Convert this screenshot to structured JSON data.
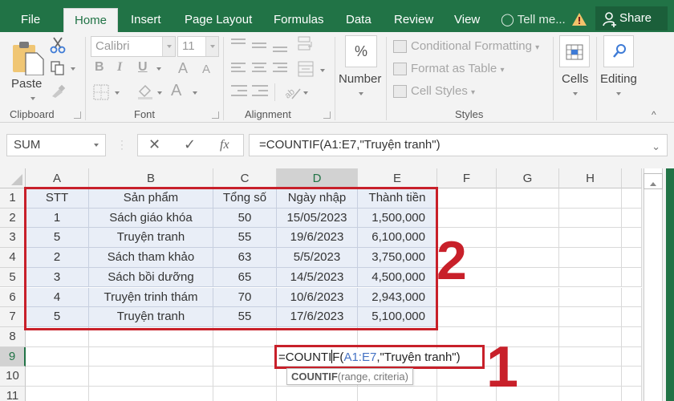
{
  "ribbon_tabs": [
    {
      "label": "File",
      "active": false
    },
    {
      "label": "Home",
      "active": true
    },
    {
      "label": "Insert",
      "active": false
    },
    {
      "label": "Page Layout",
      "active": false
    },
    {
      "label": "Formulas",
      "active": false
    },
    {
      "label": "Data",
      "active": false
    },
    {
      "label": "Review",
      "active": false
    },
    {
      "label": "View",
      "active": false
    }
  ],
  "tell_me": "Tell me...",
  "share_label": "Share",
  "clipboard": {
    "paste_label": "Paste",
    "group_label": "Clipboard"
  },
  "font": {
    "name": "Calibri",
    "size": "11",
    "group_label": "Font",
    "bold": "B",
    "italic": "I",
    "underline": "U",
    "grow": "A",
    "shrink": "A",
    "color": "A"
  },
  "alignment": {
    "group_label": "Alignment"
  },
  "number": {
    "symbol": "%",
    "label": "Number"
  },
  "styles": {
    "conditional_formatting": "Conditional Formatting",
    "format_as_table": "Format as Table",
    "cell_styles": "Cell Styles",
    "group_label": "Styles"
  },
  "cells": {
    "label": "Cells"
  },
  "editing": {
    "label": "Editing"
  },
  "formula_bar": {
    "name_box": "SUM",
    "cancel": "✕",
    "enter": "✓",
    "fx": "fx",
    "formula": "=COUNTIF(A1:E7,\"Truyện tranh\")"
  },
  "sheet": {
    "columns": [
      "A",
      "B",
      "C",
      "D",
      "E",
      "F",
      "G",
      "H"
    ],
    "rows": [
      "1",
      "2",
      "3",
      "4",
      "5",
      "6",
      "7",
      "8",
      "9",
      "10",
      "11"
    ],
    "header": [
      "STT",
      "Sản phẩm",
      "Tổng số",
      "Ngày nhập",
      "Thành tiền"
    ],
    "data": [
      [
        "1",
        "Sách giáo khóa",
        "50",
        "15/05/2023",
        "1,500,000"
      ],
      [
        "5",
        "Truyện tranh",
        "55",
        "19/6/2023",
        "6,100,000"
      ],
      [
        "2",
        "Sách tham khảo",
        "63",
        "5/5/2023",
        "3,750,000"
      ],
      [
        "3",
        "Sách bồi dưỡng",
        "65",
        "14/5/2023",
        "4,500,000"
      ],
      [
        "4",
        "Truyện trinh thám",
        "70",
        "10/6/2023",
        "2,943,000"
      ],
      [
        "5",
        "Truyện tranh",
        "55",
        "17/6/2023",
        "5,100,000"
      ]
    ],
    "active_row": "9",
    "active_col": "D"
  },
  "editing_cell": {
    "prefix": "=COUNTI",
    "after_cursor": "F(",
    "ref": "A1:E7",
    "rest": ",\"Truyện tranh\")"
  },
  "tooltip": {
    "fn": "COUNTIF",
    "args": "(range, criteria)"
  },
  "annotations": {
    "label_1": "1",
    "label_2": "2"
  },
  "colors": {
    "excel_green": "#217346",
    "annotation_red": "#c8202a",
    "selection_fill": "#e9eef7",
    "reference_blue": "#4472c4"
  }
}
